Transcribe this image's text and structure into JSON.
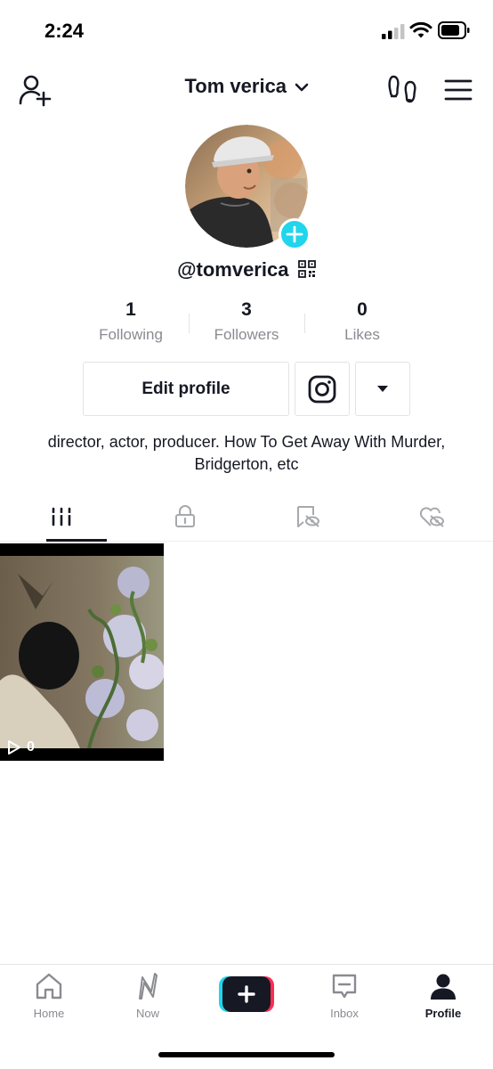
{
  "status_bar": {
    "time": "2:24"
  },
  "header": {
    "title": "Tom verica"
  },
  "profile": {
    "username": "@tomverica",
    "stats": [
      {
        "value": "1",
        "label": "Following"
      },
      {
        "value": "3",
        "label": "Followers"
      },
      {
        "value": "0",
        "label": "Likes"
      }
    ],
    "edit_label": "Edit profile",
    "bio": "director, actor, producer. How To Get Away With Murder, Bridgerton, etc"
  },
  "tabs": [
    {
      "icon": "videos-grid-icon",
      "active": true
    },
    {
      "icon": "lock-icon",
      "active": false
    },
    {
      "icon": "hidden-bookmark-icon",
      "active": false
    },
    {
      "icon": "hidden-likes-icon",
      "active": false
    }
  ],
  "videos": [
    {
      "views": "0"
    }
  ],
  "bottom_nav": [
    {
      "label": "Home",
      "icon": "home-icon"
    },
    {
      "label": "Now",
      "icon": "now-icon"
    },
    {
      "label": "",
      "icon": "create-plus-icon"
    },
    {
      "label": "Inbox",
      "icon": "inbox-icon"
    },
    {
      "label": "Profile",
      "icon": "profile-person-icon",
      "active": true
    }
  ],
  "colors": {
    "accent_cyan": "#20d5ec",
    "accent_red": "#fe2c55",
    "text_primary": "#161823",
    "text_secondary": "#8a8b91"
  }
}
